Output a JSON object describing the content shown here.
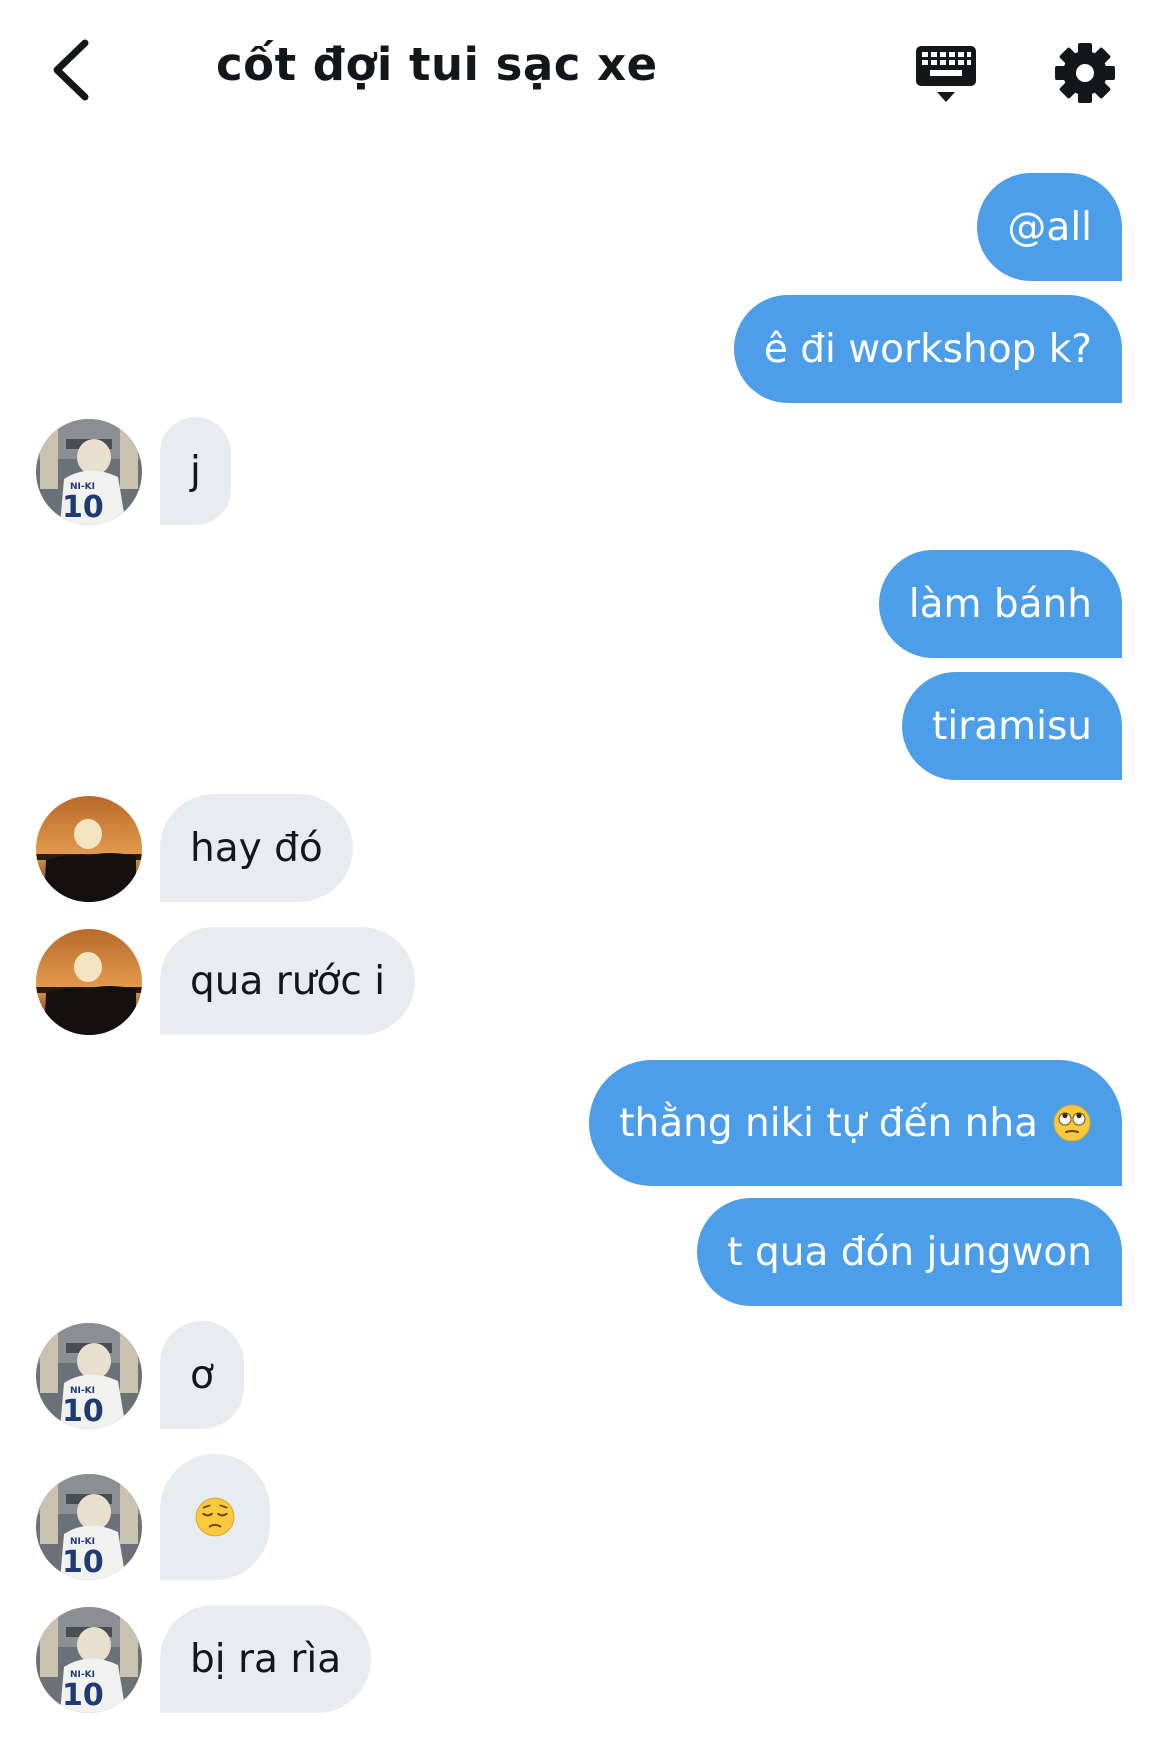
{
  "header": {
    "title": "cốt đợi tui sạc xe",
    "back_icon": "chevron-left-icon",
    "keyboard_icon": "keyboard-icon",
    "settings_icon": "gear-icon"
  },
  "colors": {
    "sent_bubble": "#4c9ee9",
    "received_bubble": "#e6ecf0",
    "text_dark": "#14171a"
  },
  "messages": [
    {
      "sender": "me",
      "text": "@all"
    },
    {
      "sender": "me",
      "text": "ê đi workshop k?"
    },
    {
      "sender": "jersey-avatar",
      "text": "j"
    },
    {
      "sender": "me",
      "text": "làm bánh"
    },
    {
      "sender": "me",
      "text": "tiramisu"
    },
    {
      "sender": "sunset-avatar",
      "text": "hay đó"
    },
    {
      "sender": "sunset-avatar",
      "text": "qua rước i"
    },
    {
      "sender": "me",
      "text": "thằng niki tự đến nha",
      "emoji": "face-with-rolling-eyes-emoji"
    },
    {
      "sender": "me",
      "text": "t qua đón jungwon"
    },
    {
      "sender": "jersey-avatar",
      "text": "ơ"
    },
    {
      "sender": "jersey-avatar",
      "text": "",
      "emoji": "pensive-face-emoji"
    },
    {
      "sender": "jersey-avatar",
      "text": "bị ra rìa"
    }
  ]
}
